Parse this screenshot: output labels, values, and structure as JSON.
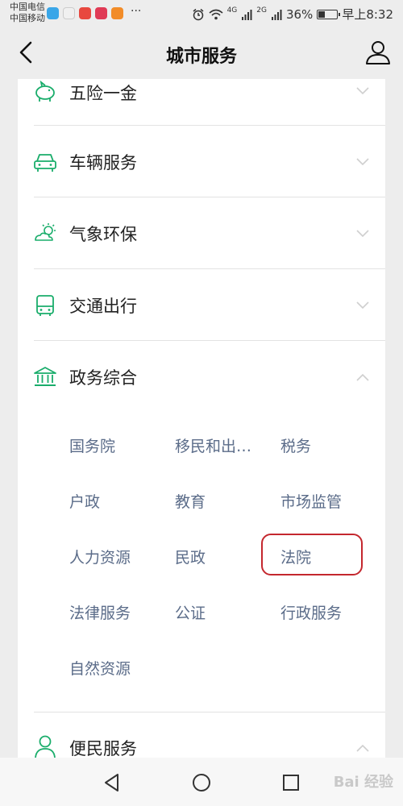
{
  "status_bar": {
    "carrier_1": "中国电信",
    "carrier_2": "中国移动",
    "more": "···",
    "signal_1": "4G",
    "signal_2": "2G",
    "battery_percent": "36%",
    "battery_level": 0.36,
    "time": "早上8:32"
  },
  "header": {
    "title": "城市服务"
  },
  "sections": [
    {
      "label": "五险一金",
      "icon": "piggy-bank-icon",
      "expanded": false
    },
    {
      "label": "车辆服务",
      "icon": "car-icon",
      "expanded": false
    },
    {
      "label": "气象环保",
      "icon": "weather-icon",
      "expanded": false
    },
    {
      "label": "交通出行",
      "icon": "bus-icon",
      "expanded": false
    },
    {
      "label": "政务综合",
      "icon": "government-building-icon",
      "expanded": true
    },
    {
      "label": "便民服务",
      "icon": "person-icon",
      "expanded": true
    }
  ],
  "government_services": [
    "国务院",
    "移民和出…",
    "税务",
    "户政",
    "教育",
    "市场监管",
    "人力资源",
    "民政",
    "法院",
    "法律服务",
    "公证",
    "行政服务",
    "自然资源"
  ],
  "highlighted_item": "法院",
  "watermark": "Bai 经验",
  "colors": {
    "accent_green": "#1aad6b",
    "link_text": "#5b6c89",
    "highlight_red": "#c4272e"
  }
}
